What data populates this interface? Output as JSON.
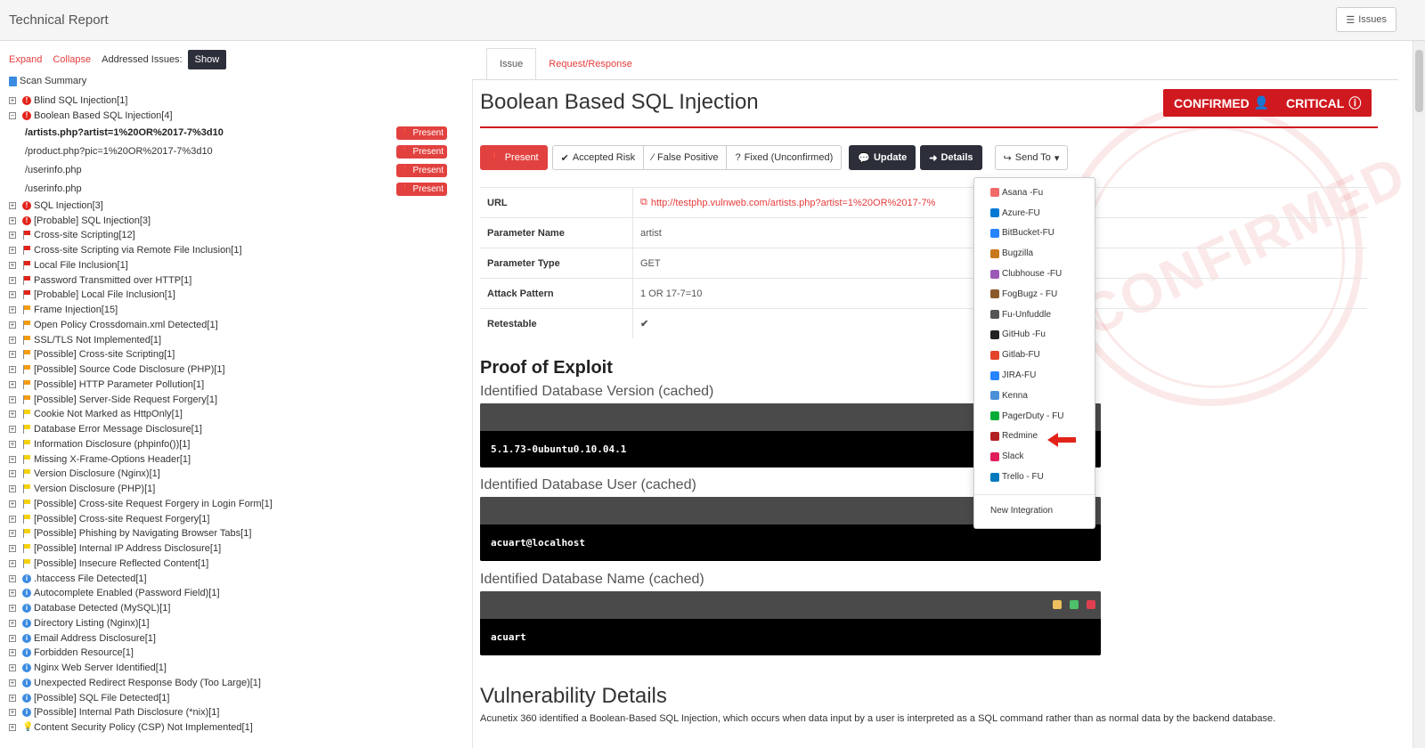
{
  "header": {
    "title": "Technical Report",
    "issues_label": "Issues"
  },
  "left": {
    "expand": "Expand",
    "collapse": "Collapse",
    "addressed_label": "Addressed Issues:",
    "show_label": "Show",
    "summary": "Scan Summary",
    "tree": [
      {
        "toggle": "+",
        "sev": "crit",
        "label": "Blind SQL Injection[1]"
      },
      {
        "toggle": "−",
        "sev": "crit",
        "label": "Boolean Based SQL Injection[4]"
      },
      {
        "child": true,
        "bold": true,
        "label": "/artists.php?artist=1%20OR%2017-7%3d10",
        "badge": "Present"
      },
      {
        "child": true,
        "label": "/product.php?pic=1%20OR%2017-7%3d10",
        "badge": "Present"
      },
      {
        "child": true,
        "label": "/userinfo.php",
        "badge": "Present"
      },
      {
        "child": true,
        "label": "/userinfo.php",
        "badge": "Present"
      },
      {
        "toggle": "+",
        "sev": "crit",
        "label": "SQL Injection[3]"
      },
      {
        "toggle": "+",
        "sev": "crit",
        "label": "[Probable] SQL Injection[3]"
      },
      {
        "toggle": "+",
        "sev": "high",
        "label": "Cross-site Scripting[12]"
      },
      {
        "toggle": "+",
        "sev": "high",
        "label": "Cross-site Scripting via Remote File Inclusion[1]"
      },
      {
        "toggle": "+",
        "sev": "high",
        "label": "Local File Inclusion[1]"
      },
      {
        "toggle": "+",
        "sev": "high",
        "label": "Password Transmitted over HTTP[1]"
      },
      {
        "toggle": "+",
        "sev": "high",
        "label": "[Probable] Local File Inclusion[1]"
      },
      {
        "toggle": "+",
        "sev": "med",
        "label": "Frame Injection[15]"
      },
      {
        "toggle": "+",
        "sev": "med",
        "label": "Open Policy Crossdomain.xml Detected[1]"
      },
      {
        "toggle": "+",
        "sev": "med",
        "label": "SSL/TLS Not Implemented[1]"
      },
      {
        "toggle": "+",
        "sev": "med",
        "label": "[Possible] Cross-site Scripting[1]"
      },
      {
        "toggle": "+",
        "sev": "med",
        "label": "[Possible] Source Code Disclosure (PHP)[1]"
      },
      {
        "toggle": "+",
        "sev": "med",
        "label": "[Possible] HTTP Parameter Pollution[1]"
      },
      {
        "toggle": "+",
        "sev": "med",
        "label": "[Possible] Server-Side Request Forgery[1]"
      },
      {
        "toggle": "+",
        "sev": "low",
        "label": "Cookie Not Marked as HttpOnly[1]"
      },
      {
        "toggle": "+",
        "sev": "low",
        "label": "Database Error Message Disclosure[1]"
      },
      {
        "toggle": "+",
        "sev": "low",
        "label": "Information Disclosure (phpinfo())[1]"
      },
      {
        "toggle": "+",
        "sev": "low",
        "label": "Missing X-Frame-Options Header[1]"
      },
      {
        "toggle": "+",
        "sev": "low",
        "label": "Version Disclosure (Nginx)[1]"
      },
      {
        "toggle": "+",
        "sev": "low",
        "label": "Version Disclosure (PHP)[1]"
      },
      {
        "toggle": "+",
        "sev": "low",
        "label": "[Possible] Cross-site Request Forgery in Login Form[1]"
      },
      {
        "toggle": "+",
        "sev": "low",
        "label": "[Possible] Cross-site Request Forgery[1]"
      },
      {
        "toggle": "+",
        "sev": "low",
        "label": "[Possible] Phishing by Navigating Browser Tabs[1]"
      },
      {
        "toggle": "+",
        "sev": "low",
        "label": "[Possible] Internal IP Address Disclosure[1]"
      },
      {
        "toggle": "+",
        "sev": "low",
        "label": "[Possible] Insecure Reflected Content[1]"
      },
      {
        "toggle": "+",
        "sev": "info",
        "label": ".htaccess File Detected[1]"
      },
      {
        "toggle": "+",
        "sev": "info",
        "label": "Autocomplete Enabled (Password Field)[1]"
      },
      {
        "toggle": "+",
        "sev": "info",
        "label": "Database Detected (MySQL)[1]"
      },
      {
        "toggle": "+",
        "sev": "info",
        "label": "Directory Listing (Nginx)[1]"
      },
      {
        "toggle": "+",
        "sev": "info",
        "label": "Email Address Disclosure[1]"
      },
      {
        "toggle": "+",
        "sev": "info",
        "label": "Forbidden Resource[1]"
      },
      {
        "toggle": "+",
        "sev": "info",
        "label": "Nginx Web Server Identified[1]"
      },
      {
        "toggle": "+",
        "sev": "info",
        "label": "Unexpected Redirect Response Body (Too Large)[1]"
      },
      {
        "toggle": "+",
        "sev": "info",
        "label": "[Possible] SQL File Detected[1]"
      },
      {
        "toggle": "+",
        "sev": "info",
        "label": "[Possible] Internal Path Disclosure (*nix)[1]"
      },
      {
        "toggle": "+",
        "sev": "bulb",
        "label": "Content Security Policy (CSP) Not Implemented[1]"
      }
    ]
  },
  "colors": {
    "crit": "#e2231a",
    "high": "#e2231a",
    "med": "#f39c12",
    "low": "#f5d20a",
    "info": "#3b8be0",
    "accent": "#d0181f",
    "dark": "#2c2f3a"
  },
  "tabs": {
    "issue": "Issue",
    "request": "Request/Response"
  },
  "issue": {
    "title": "Boolean Based SQL Injection",
    "confirmed": "CONFIRMED",
    "critical": "CRITICAL",
    "stamp": "CONFIRMED",
    "actions": {
      "present": "Present",
      "accepted": "Accepted Risk",
      "false_pos": "False Positive",
      "fixed": "Fixed (Unconfirmed)",
      "update": "Update",
      "details": "Details",
      "send_to": "Send To"
    },
    "details": [
      {
        "key": "URL",
        "value": "http://testphp.vulnweb.com/artists.php?artist=1%20OR%2017-7%",
        "link": true
      },
      {
        "key": "Parameter Name",
        "value": "artist"
      },
      {
        "key": "Parameter Type",
        "value": "GET"
      },
      {
        "key": "Attack Pattern",
        "value": "1 OR 17-7=10"
      },
      {
        "key": "Retestable",
        "value": "✔",
        "check": true
      }
    ],
    "proof_title": "Proof of Exploit",
    "proofs": [
      {
        "label": "Identified Database Version (cached)",
        "value": "5.1.73-0ubuntu0.10.04.1"
      },
      {
        "label": "Identified Database User (cached)",
        "value": "acuart@localhost"
      },
      {
        "label": "Identified Database Name (cached)",
        "value": "acuart"
      }
    ],
    "vuln_title": "Vulnerability Details",
    "vuln_desc": "Acunetix 360 identified a Boolean-Based SQL Injection, which occurs when data input by a user is interpreted as a SQL command rather than as normal data by the backend database."
  },
  "dropdown": {
    "items": [
      {
        "label": "Asana -Fu",
        "color": "#f06a6a"
      },
      {
        "label": "Azure-FU",
        "color": "#0078d4"
      },
      {
        "label": "BitBucket-FU",
        "color": "#2684ff"
      },
      {
        "label": "Bugzilla",
        "color": "#c9771c"
      },
      {
        "label": "Clubhouse -FU",
        "color": "#9b59b6"
      },
      {
        "label": "FogBugz - FU",
        "color": "#8a5a2b"
      },
      {
        "label": "Fu-Unfuddle",
        "color": "#555555"
      },
      {
        "label": "GitHub -Fu",
        "color": "#222222"
      },
      {
        "label": "Gitlab-FU",
        "color": "#e24329"
      },
      {
        "label": "JIRA-FU",
        "color": "#2684ff"
      },
      {
        "label": "Kenna",
        "color": "#4a90d9"
      },
      {
        "label": "PagerDuty - FU",
        "color": "#06ac38"
      },
      {
        "label": "Redmine",
        "color": "#b32024"
      },
      {
        "label": "Slack",
        "color": "#e01e5a"
      },
      {
        "label": "Trello - FU",
        "color": "#0079bf"
      }
    ],
    "new_integration": "New Integration"
  }
}
